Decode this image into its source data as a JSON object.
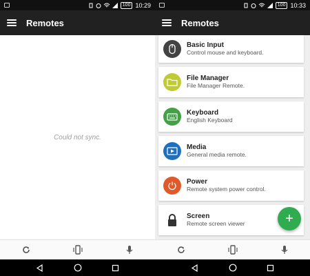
{
  "left": {
    "status": {
      "time": "10:29",
      "battery": "100"
    },
    "appbar": {
      "title": "Remotes"
    },
    "content": {
      "message": "Could not sync."
    }
  },
  "right": {
    "status": {
      "time": "10:33",
      "battery": "100"
    },
    "appbar": {
      "title": "Remotes"
    },
    "remotes": [
      {
        "name": "Basic Input",
        "description": "Control mouse and keyboard.",
        "icon": "mouse-icon",
        "color": "#424242"
      },
      {
        "name": "File Manager",
        "description": "File Manager Remote.",
        "icon": "folder-icon",
        "color": "#c0ca33"
      },
      {
        "name": "Keyboard",
        "description": "English Keyboard",
        "icon": "keyboard-icon",
        "color": "#43a047"
      },
      {
        "name": "Media",
        "description": "General media remote.",
        "icon": "media-icon",
        "color": "#1e6fbe"
      },
      {
        "name": "Power",
        "description": "Remote system power control.",
        "icon": "power-icon",
        "color": "#e0592a"
      },
      {
        "name": "Screen",
        "description": "Remote screen viewer",
        "icon": "lock-icon",
        "color": "#333333"
      }
    ],
    "fab": {
      "label": "+"
    }
  },
  "colors": {
    "appbar": "#212121",
    "statusbar": "#111111",
    "fab": "#2eac4f",
    "muted_text": "#9e9e9e"
  }
}
